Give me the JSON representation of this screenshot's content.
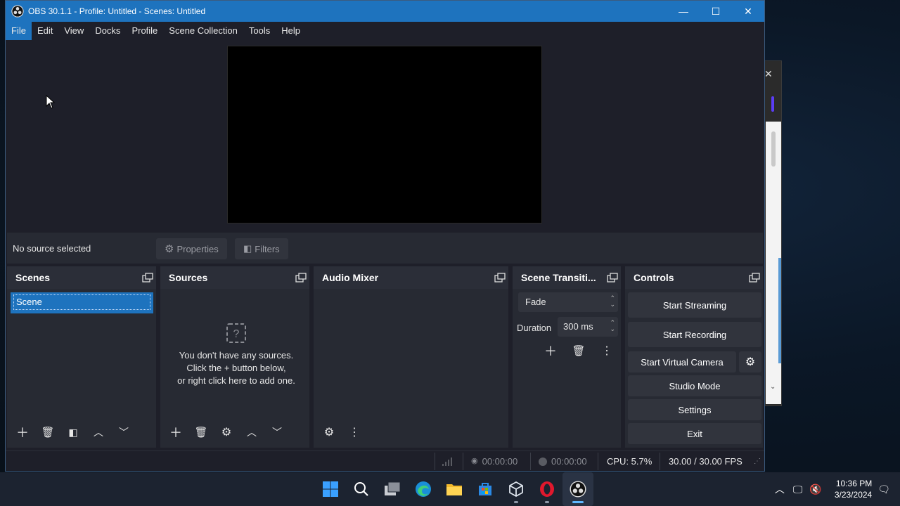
{
  "window": {
    "title": "OBS 30.1.1 - Profile: Untitled - Scenes: Untitled"
  },
  "menu": [
    "File",
    "Edit",
    "View",
    "Docks",
    "Profile",
    "Scene Collection",
    "Tools",
    "Help"
  ],
  "source_toolbar": {
    "no_source": "No source selected",
    "properties": "Properties",
    "filters": "Filters"
  },
  "docks": {
    "scenes": {
      "title": "Scenes",
      "items": [
        "Scene"
      ]
    },
    "sources": {
      "title": "Sources",
      "empty_line1": "You don't have any sources.",
      "empty_line2": "Click the + button below,",
      "empty_line3": "or right click here to add one."
    },
    "audio_mixer": {
      "title": "Audio Mixer"
    },
    "transitions": {
      "title": "Scene Transiti...",
      "selected": "Fade",
      "duration_label": "Duration",
      "duration_value": "300 ms"
    },
    "controls": {
      "title": "Controls",
      "start_streaming": "Start Streaming",
      "start_recording": "Start Recording",
      "start_virtual_camera": "Start Virtual Camera",
      "studio_mode": "Studio Mode",
      "settings": "Settings",
      "exit": "Exit"
    }
  },
  "status": {
    "stream_time": "00:00:00",
    "record_time": "00:00:00",
    "cpu": "CPU: 5.7%",
    "fps": "30.00 / 30.00 FPS"
  },
  "taskbar": {
    "time": "10:36 PM",
    "date": "3/23/2024",
    "apps": [
      "windows-start-icon",
      "search-icon",
      "task-view-icon",
      "edge-icon",
      "file-explorer-icon",
      "store-icon",
      "virtualbox-icon",
      "opera-icon",
      "obs-icon"
    ]
  },
  "colors": {
    "accent": "#1e73be",
    "panel": "#272a33",
    "window_bg": "#1e1f29",
    "button": "#31343d"
  }
}
